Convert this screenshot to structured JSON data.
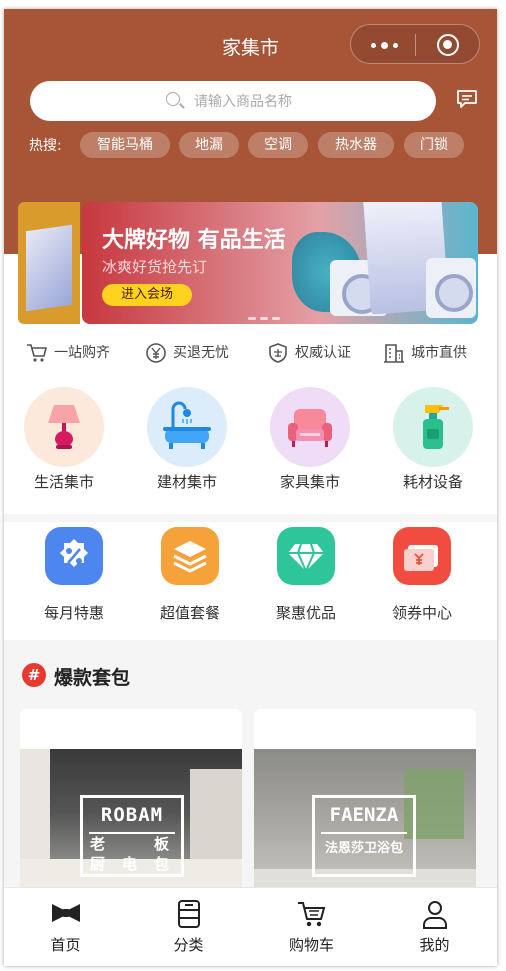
{
  "header": {
    "title": "家集市"
  },
  "search": {
    "placeholder": "请输入商品名称"
  },
  "hot": {
    "label": "热搜:",
    "tags": [
      "智能马桶",
      "地漏",
      "空调",
      "热水器",
      "门锁"
    ]
  },
  "banner": {
    "title": "大牌好物 有品生活",
    "subtitle": "冰爽好货抢先订",
    "button": "进入会场"
  },
  "features": [
    "一站购齐",
    "买退无忧",
    "权威认证",
    "城市直供"
  ],
  "categories": [
    {
      "label": "生活集市",
      "icon": "lamp-icon"
    },
    {
      "label": "建材集市",
      "icon": "bathtub-icon"
    },
    {
      "label": "家具集市",
      "icon": "sofa-icon"
    },
    {
      "label": "耗材设备",
      "icon": "spray-bottle-icon"
    }
  ],
  "promos": [
    {
      "label": "每月特惠",
      "icon": "percent-icon",
      "color": "#4e86f0"
    },
    {
      "label": "超值套餐",
      "icon": "layers-icon",
      "color": "#f5a23b"
    },
    {
      "label": "聚惠优品",
      "icon": "diamond-icon",
      "color": "#2fc59a"
    },
    {
      "label": "领券中心",
      "icon": "coupon-icon",
      "color": "#f04c3f"
    }
  ],
  "section": {
    "hash": "#",
    "title": "爆款套包"
  },
  "packages": [
    {
      "logo": "ROBAM",
      "sub1": "老",
      "sub2": "板",
      "sub3": "厨",
      "sub4": "电",
      "sub5": "包"
    },
    {
      "logo": "FAENZA",
      "sub": "法恩莎卫浴包"
    }
  ],
  "tabbar": [
    {
      "label": "首页",
      "icon": "home-bowtie-icon"
    },
    {
      "label": "分类",
      "icon": "category-icon"
    },
    {
      "label": "购物车",
      "icon": "cart-icon"
    },
    {
      "label": "我的",
      "icon": "user-icon"
    }
  ],
  "colors": {
    "header_bg": "#a85537",
    "accent": "#e8392f",
    "banner_button": "#ffd21f"
  }
}
